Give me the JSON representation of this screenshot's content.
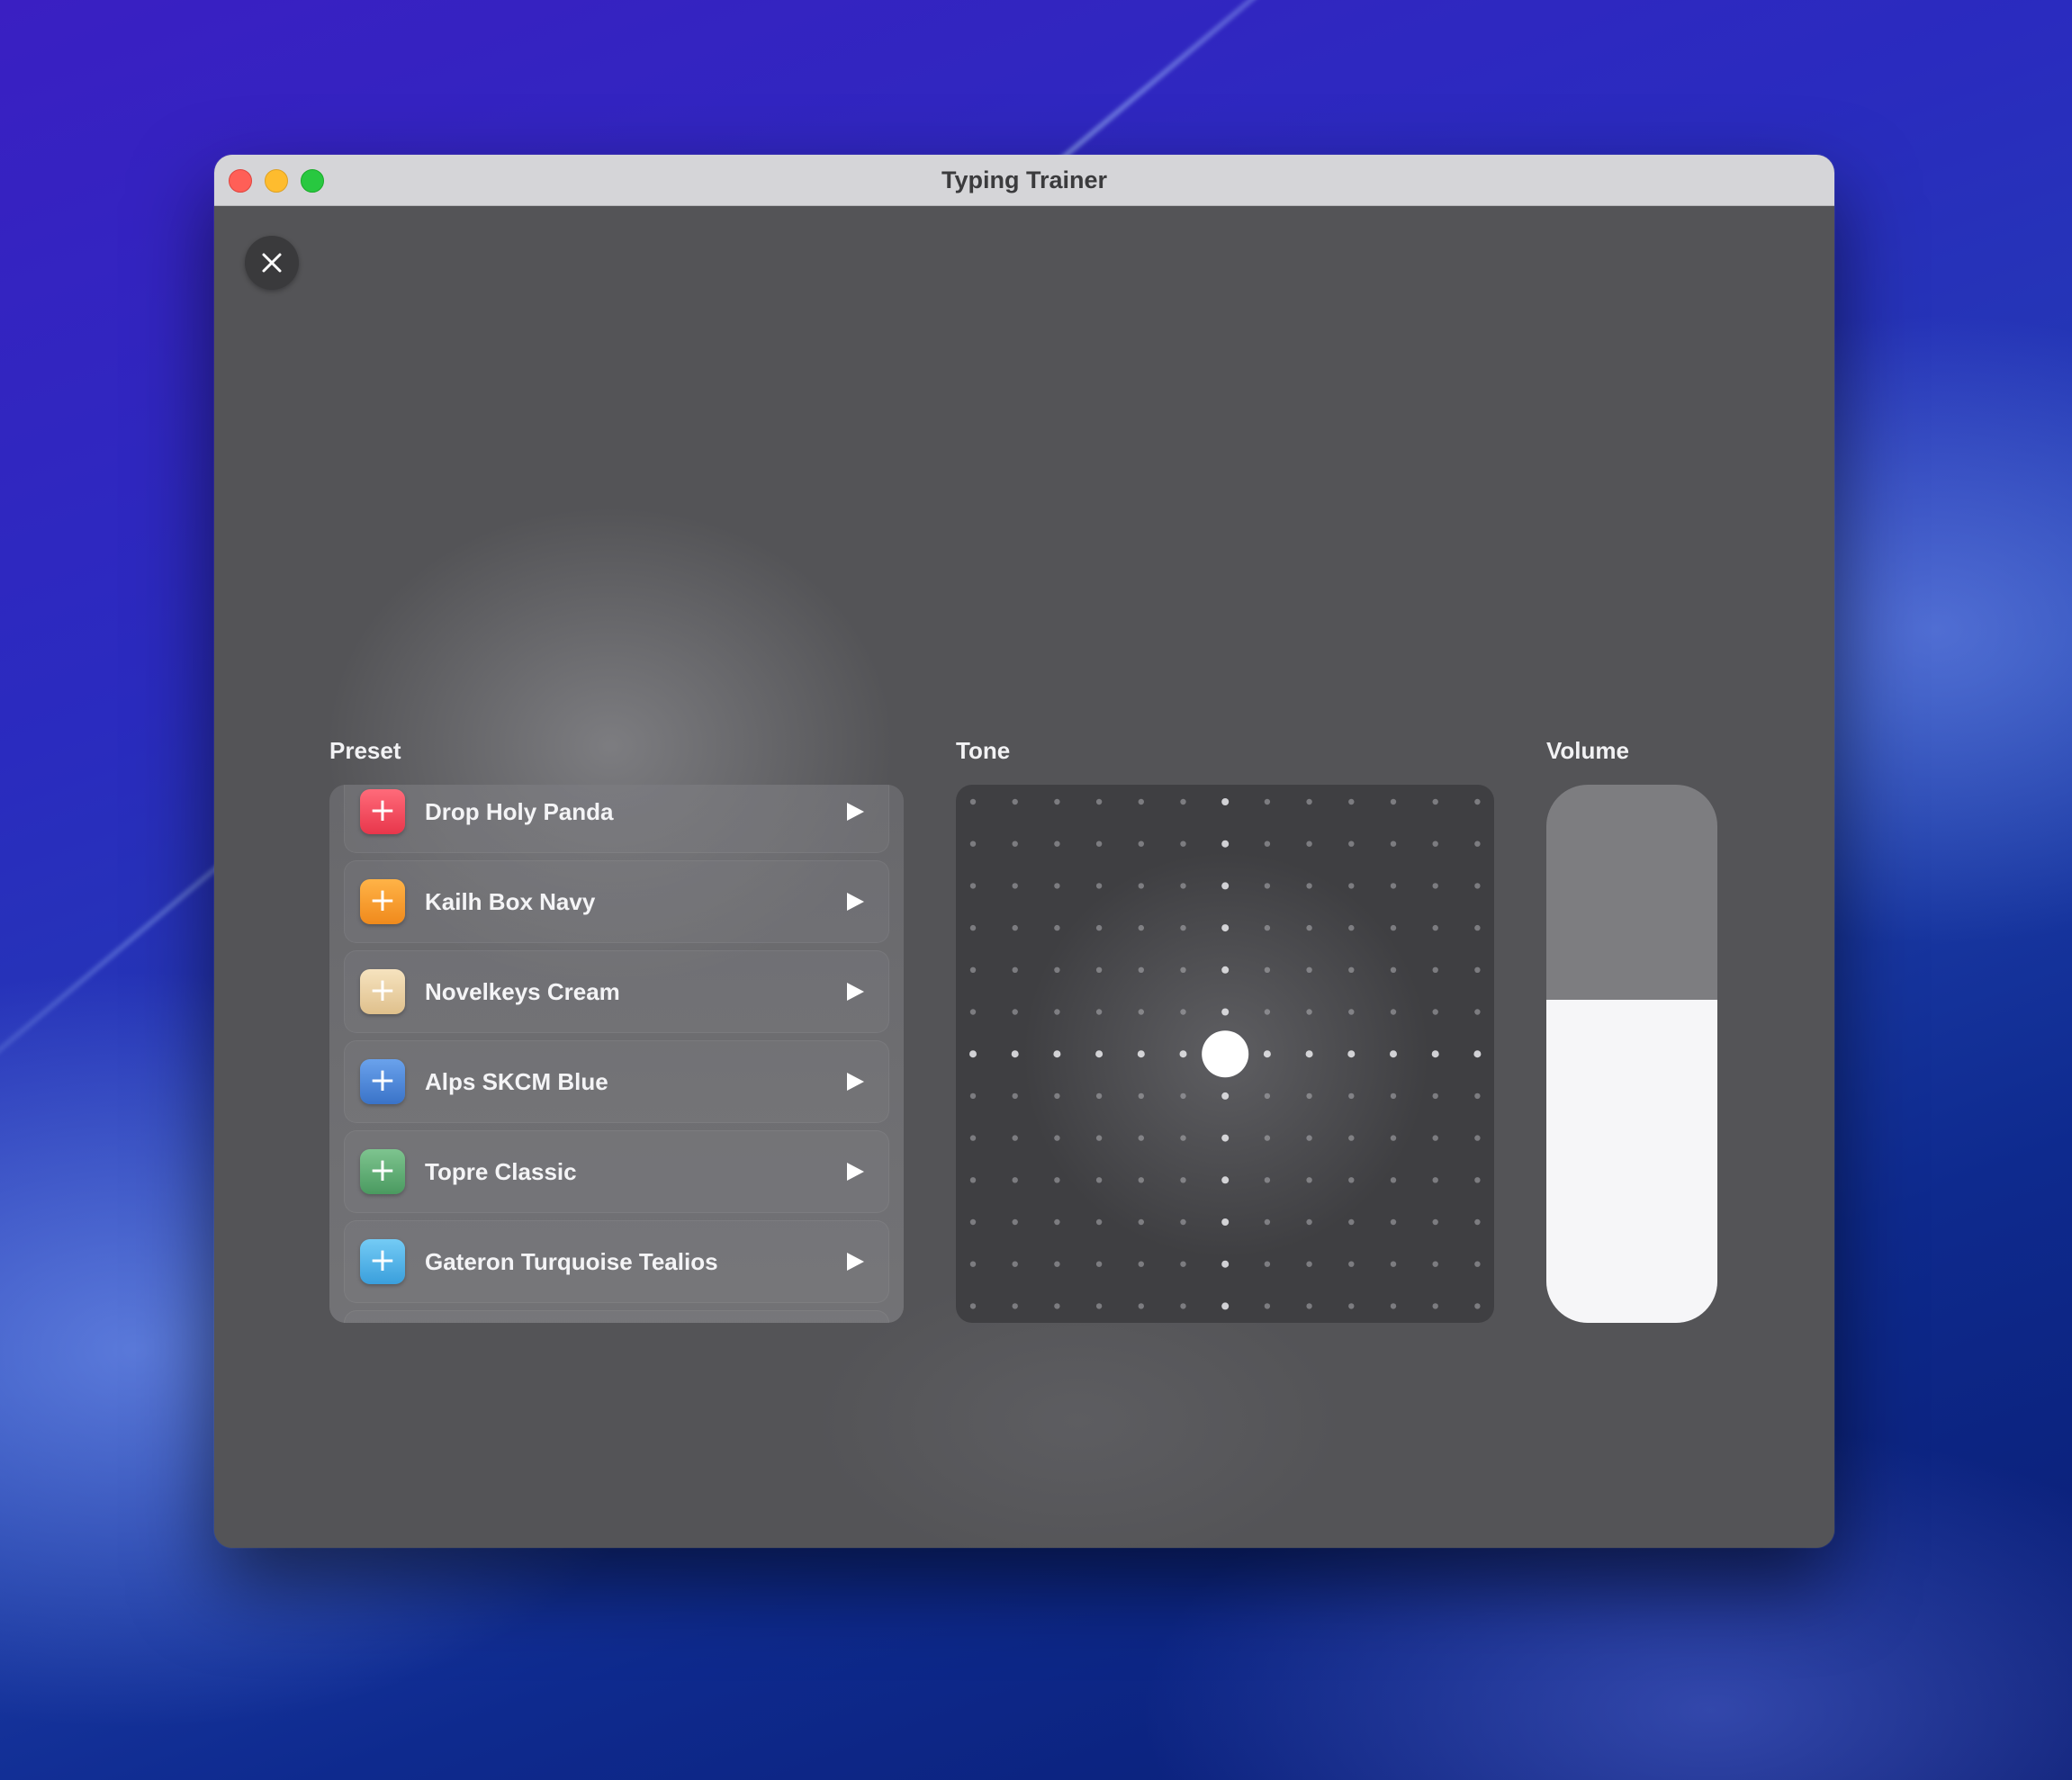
{
  "window": {
    "title": "Typing Trainer"
  },
  "dismiss_icon": "close-icon",
  "labels": {
    "preset": "Preset",
    "tone": "Tone",
    "volume": "Volume"
  },
  "presets": [
    {
      "name": "Drop Holy Panda",
      "icon": "plus-icon",
      "color": "#f0465a"
    },
    {
      "name": "Kailh Box Navy",
      "icon": "plus-icon",
      "color": "#f59a2b"
    },
    {
      "name": "Novelkeys Cream",
      "icon": "plus-icon",
      "color": "#ecd3a6"
    },
    {
      "name": "Alps SKCM Blue",
      "icon": "plus-icon",
      "color": "#4a86d8"
    },
    {
      "name": "Topre Classic",
      "icon": "plus-icon",
      "color": "#5fae73"
    },
    {
      "name": "Gateron Turquoise Tealios",
      "icon": "plus-icon",
      "color": "#4fb3ea"
    }
  ],
  "tone": {
    "grid_columns": 13,
    "grid_rows": 13,
    "selected_column": 7,
    "selected_row": 7
  },
  "volume": {
    "level": 0.6
  },
  "colors": {
    "accent": "#f6f6f8",
    "panel": "#545457"
  }
}
